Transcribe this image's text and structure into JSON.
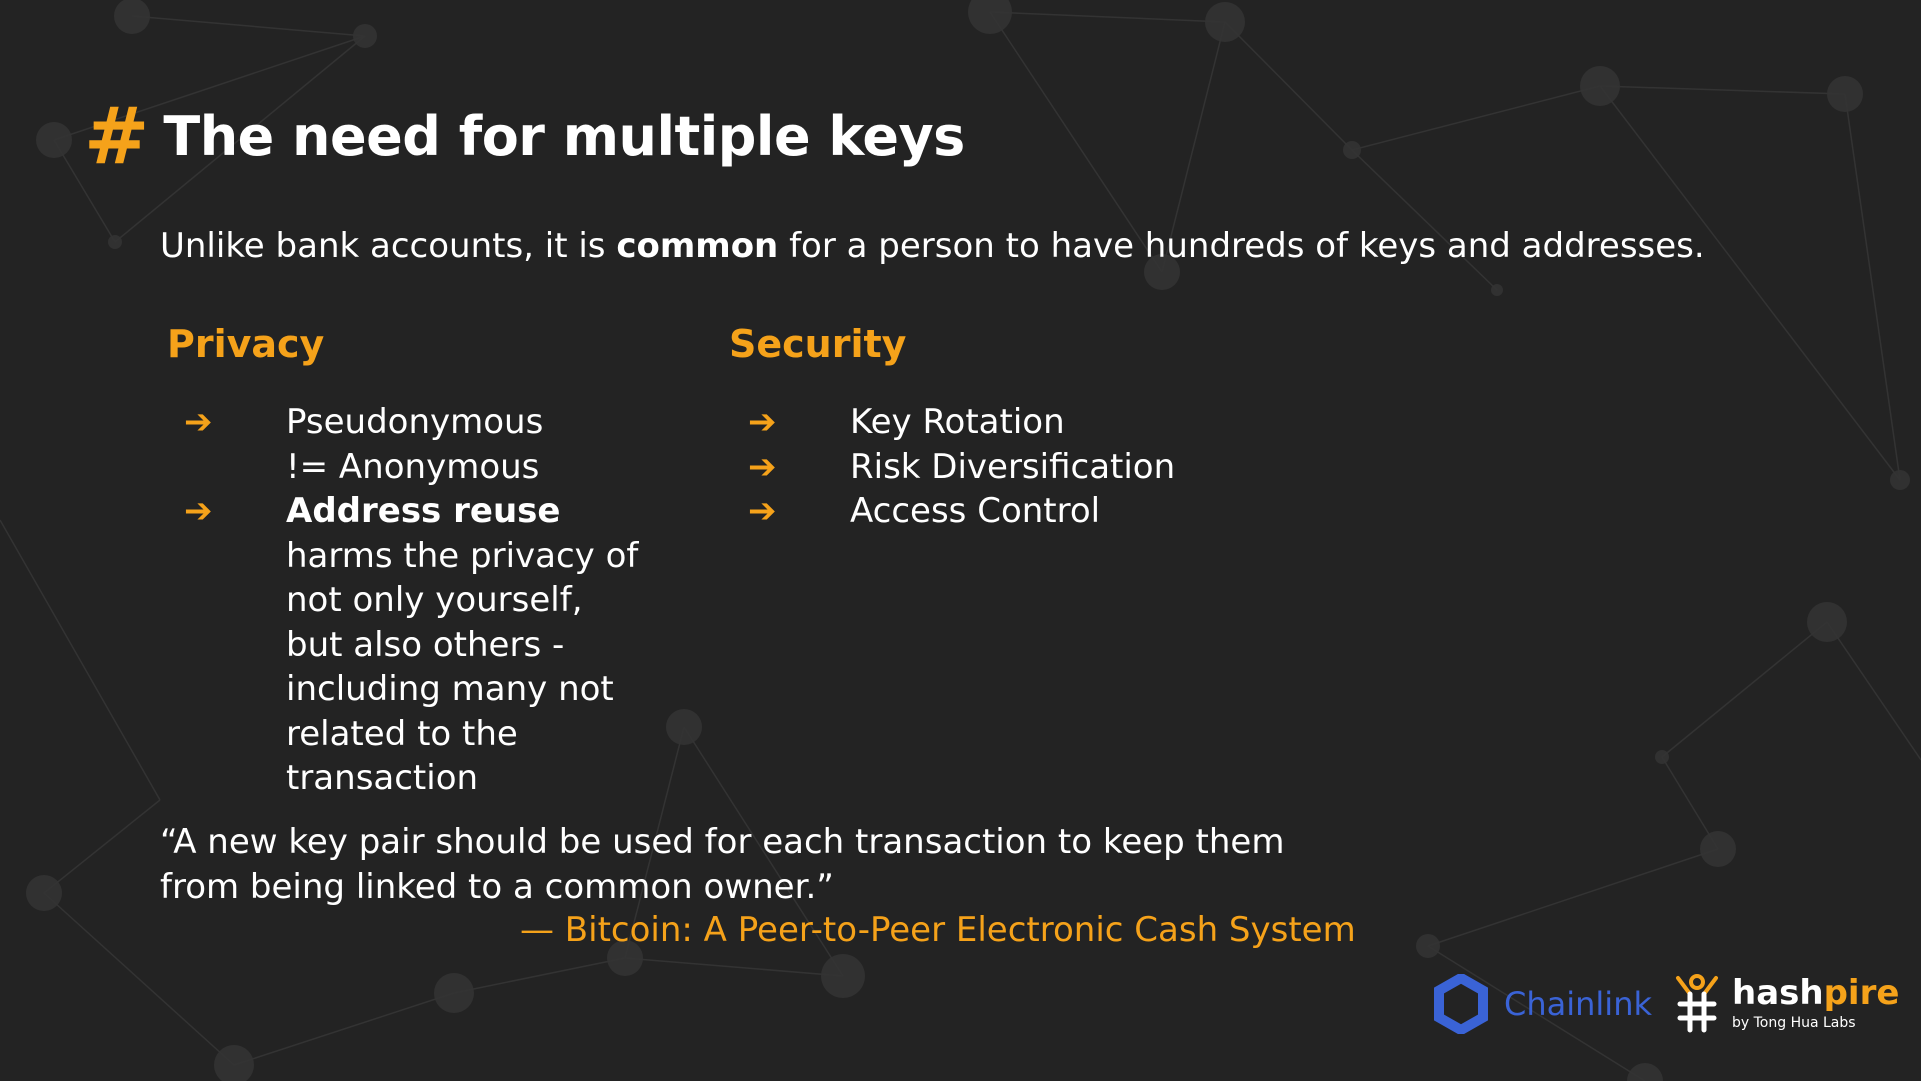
{
  "slide": {
    "hash_symbol": "#",
    "title": "The need for multiple keys",
    "intro": {
      "before": "Unlike bank accounts, it is ",
      "bold": "common",
      "after": " for a person to have hundreds of keys and addresses."
    },
    "privacy": {
      "heading": "Privacy",
      "items": [
        {
          "bold": "",
          "text": "Pseudonymous != Anonymous"
        },
        {
          "bold": "Address reuse",
          "text": " harms the privacy of not only yourself, but also others - including many not related to the transaction"
        }
      ]
    },
    "security": {
      "heading": "Security",
      "items": [
        {
          "text": "Key Rotation"
        },
        {
          "text": "Risk Diversification"
        },
        {
          "text": "Access Control"
        }
      ]
    },
    "quote": "“A new key pair should be used for each transaction to keep them from being linked to a common owner.”",
    "citation": "— Bitcoin: A Peer-to-Peer Electronic Cash System",
    "arrow_glyph": "➔"
  },
  "logos": {
    "chainlink": "Chainlink",
    "hashpire_main_a": "hash",
    "hashpire_main_b": "pire",
    "hashpire_sub": "by Tong Hua Labs"
  },
  "colors": {
    "background": "#232323",
    "accent": "#f5a21a",
    "chainlink_blue": "#3a63d6",
    "text": "#ffffff"
  }
}
